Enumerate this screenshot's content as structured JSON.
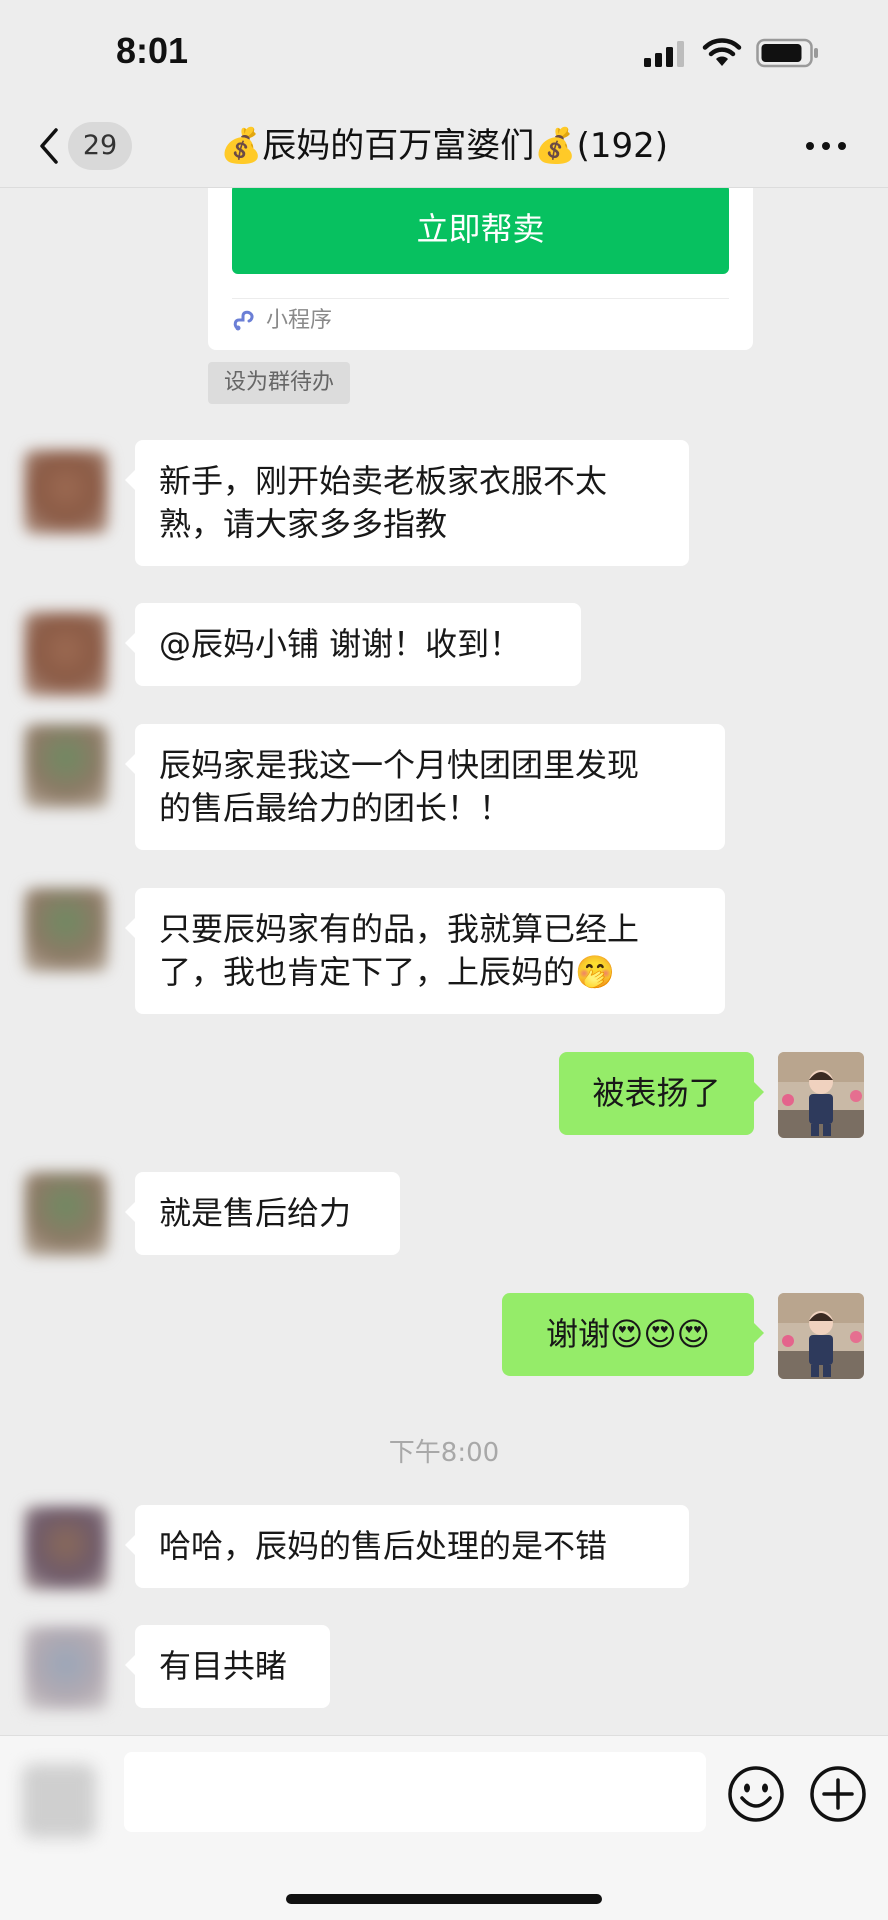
{
  "status_bar": {
    "time": "8:01"
  },
  "nav": {
    "unread_count": "29",
    "title": "💰辰妈的百万富婆们💰(192)"
  },
  "card": {
    "button_label": "立即帮卖",
    "source_label": "小程序"
  },
  "todo_chip": "设为群待办",
  "messages": [
    {
      "side": "left",
      "text_line1": "新手，刚开始卖老板家衣服不太",
      "text_line2": "熟，请大家多多指教"
    },
    {
      "side": "left",
      "text_line1": "@辰妈小铺 谢谢！收到！"
    },
    {
      "side": "left",
      "text_line1": "辰妈家是我这一个月快团团里发现",
      "text_line2": "的售后最给力的团长！！"
    },
    {
      "side": "left",
      "text_line1": "只要辰妈家有的品，我就算已经上",
      "text_line2": "了，我也肯定下了，上辰妈的🤭"
    },
    {
      "side": "right",
      "text_line1": "被表扬了"
    },
    {
      "side": "left",
      "text_line1": "就是售后给力"
    },
    {
      "side": "right",
      "text_line1": "谢谢😍😍😍"
    },
    {
      "side": "left",
      "text_line1": "哈哈，辰妈的售后处理的是不错"
    },
    {
      "side": "left",
      "text_line1": "有目共睹"
    }
  ],
  "timestamp": "下午8:00",
  "input": {
    "placeholder": ""
  },
  "icons": {
    "back": "chevron-left-icon",
    "more": "ellipsis-icon",
    "emoji": "smiley-icon",
    "plus": "plus-circle-icon",
    "mini_program": "link-icon"
  },
  "colors": {
    "accent_green": "#07c160",
    "my_bubble": "#95ec69",
    "background": "#ededed"
  }
}
